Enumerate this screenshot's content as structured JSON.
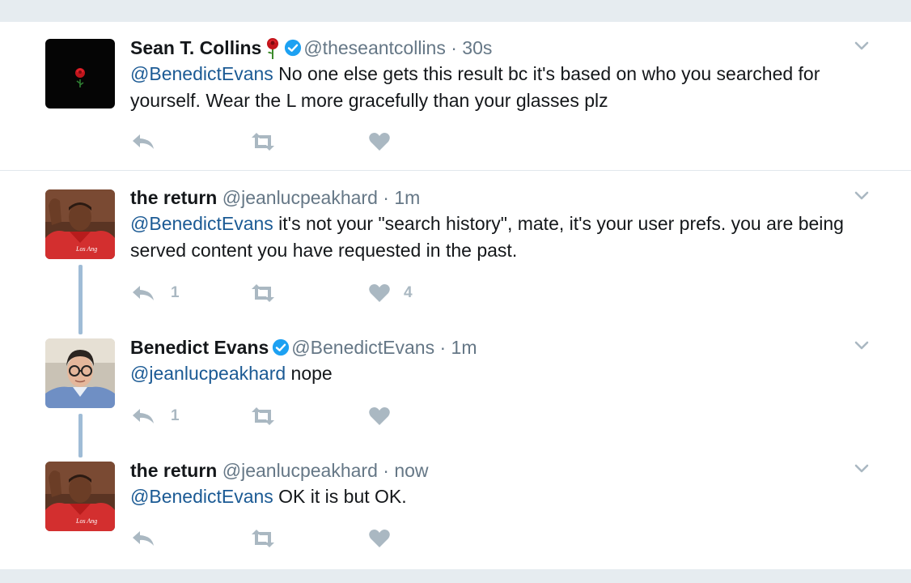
{
  "tweets": [
    {
      "name": "Sean T. Collins",
      "handle": "@theseantcollins",
      "separator": "·",
      "time": "30s",
      "mention": "@BenedictEvans",
      "body": " No one else gets this result bc it's based on who you searched for yourself. Wear the L more gracefully than your glasses plz",
      "reply_count": "",
      "retweet_count": "",
      "like_count": ""
    },
    {
      "name": "the return",
      "handle": "@jeanlucpeakhard",
      "separator": "·",
      "time": "1m",
      "mention": "@BenedictEvans",
      "body": " it's not your \"search history\", mate, it's your user prefs. you are being served content you have requested in the past.",
      "reply_count": "1",
      "retweet_count": "",
      "like_count": "4"
    },
    {
      "name": "Benedict Evans",
      "handle": "@BenedictEvans",
      "separator": "·",
      "time": "1m",
      "mention": "@jeanlucpeakhard",
      "body": " nope",
      "reply_count": "1",
      "retweet_count": "",
      "like_count": ""
    },
    {
      "name": "the return",
      "handle": "@jeanlucpeakhard",
      "separator": "·",
      "time": "now",
      "mention": "@BenedictEvans",
      "body": " OK it is but OK.",
      "reply_count": "",
      "retweet_count": "",
      "like_count": ""
    }
  ],
  "icons": {
    "reply": "reply-icon",
    "retweet": "retweet-icon",
    "like": "heart-icon",
    "caret": "chevron-down-icon",
    "verified": "verified-badge-icon",
    "rose": "rose-emoji-icon"
  },
  "colors": {
    "mention": "#1b5a94",
    "verified": "#1da1f2",
    "action_icon": "#aab8c2",
    "thread_line": "#9fbcd6"
  }
}
